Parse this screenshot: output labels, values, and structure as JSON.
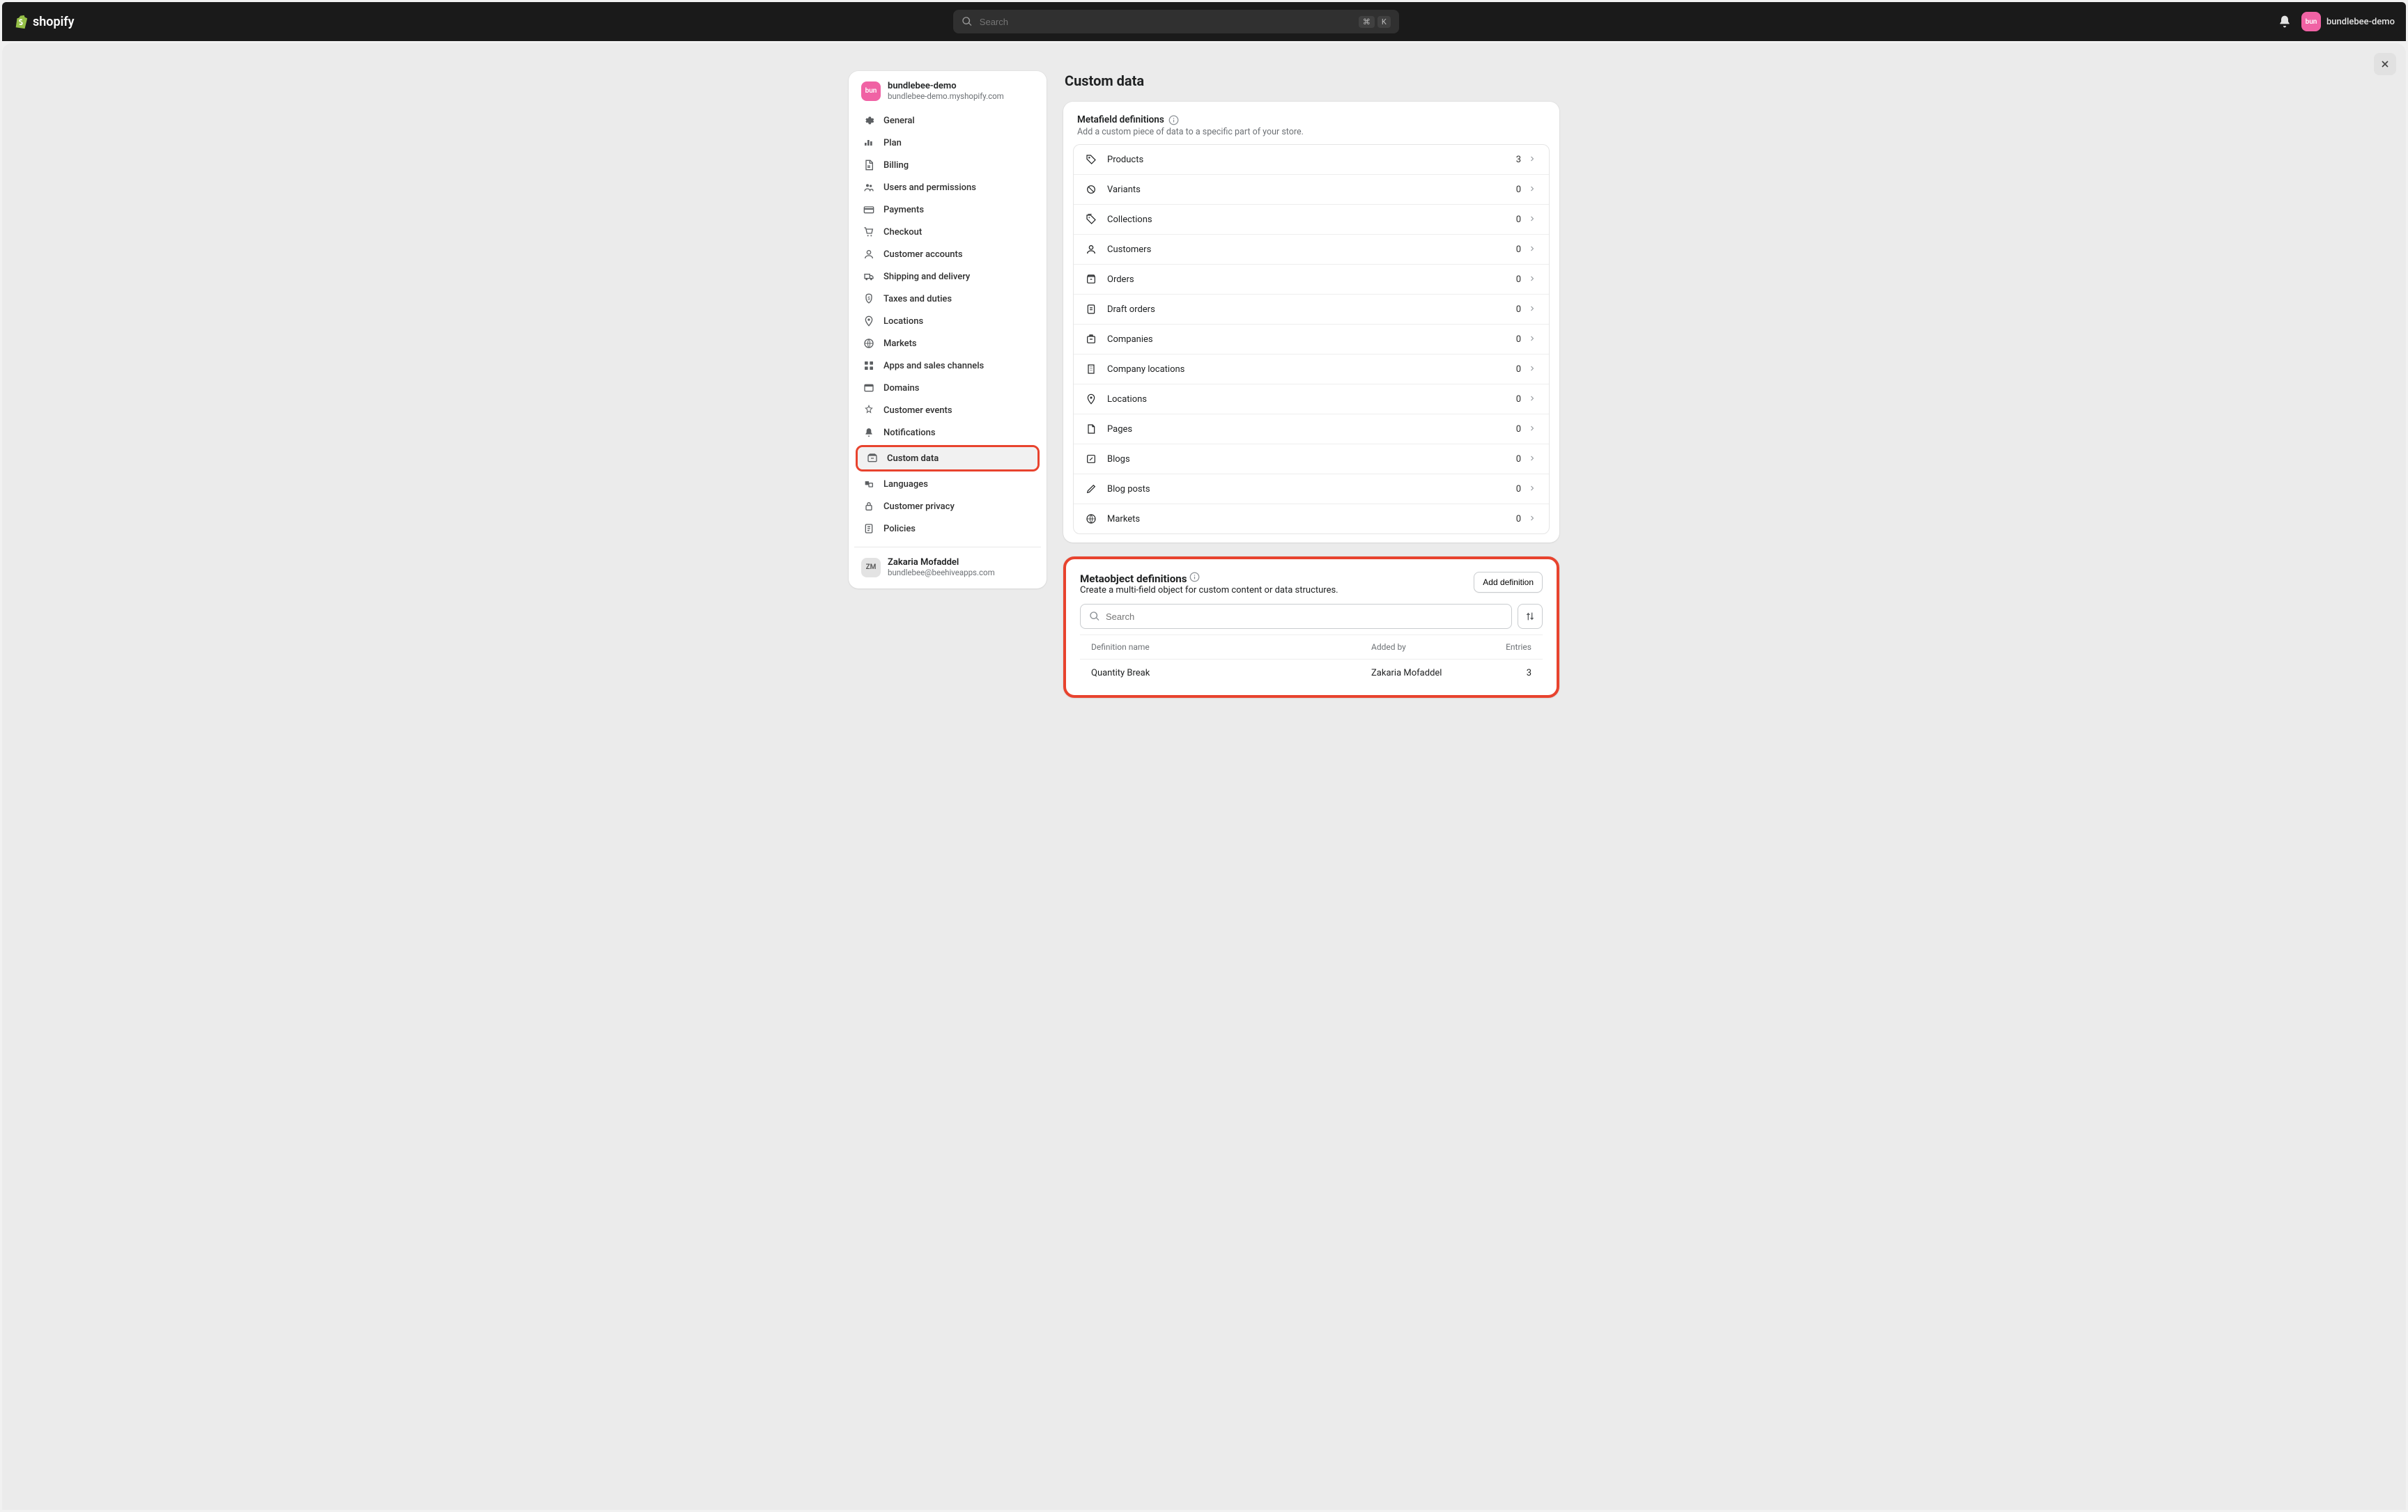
{
  "topbar": {
    "brand": "shopify",
    "search_placeholder": "Search",
    "kbd1": "⌘",
    "kbd2": "K",
    "avatar_text": "bun",
    "store_name": "bundlebee-demo"
  },
  "sidebar": {
    "store": {
      "avatar": "bun",
      "name": "bundlebee-demo",
      "domain": "bundlebee-demo.myshopify.com"
    },
    "items": [
      {
        "label": "General",
        "icon": "settings"
      },
      {
        "label": "Plan",
        "icon": "plan"
      },
      {
        "label": "Billing",
        "icon": "billing"
      },
      {
        "label": "Users and permissions",
        "icon": "users"
      },
      {
        "label": "Payments",
        "icon": "payments"
      },
      {
        "label": "Checkout",
        "icon": "checkout"
      },
      {
        "label": "Customer accounts",
        "icon": "customer"
      },
      {
        "label": "Shipping and delivery",
        "icon": "shipping"
      },
      {
        "label": "Taxes and duties",
        "icon": "taxes"
      },
      {
        "label": "Locations",
        "icon": "locations"
      },
      {
        "label": "Markets",
        "icon": "markets"
      },
      {
        "label": "Apps and sales channels",
        "icon": "apps"
      },
      {
        "label": "Domains",
        "icon": "domains"
      },
      {
        "label": "Customer events",
        "icon": "events"
      },
      {
        "label": "Notifications",
        "icon": "notifications"
      },
      {
        "label": "Custom data",
        "icon": "customdata"
      },
      {
        "label": "Languages",
        "icon": "languages"
      },
      {
        "label": "Customer privacy",
        "icon": "privacy"
      },
      {
        "label": "Policies",
        "icon": "policies"
      }
    ],
    "footer": {
      "initials": "ZM",
      "name": "Zakaria Mofaddel",
      "email": "bundlebee@beehiveapps.com"
    }
  },
  "main": {
    "title": "Custom data",
    "metafield": {
      "heading": "Metafield definitions",
      "subtitle": "Add a custom piece of data to a specific part of your store.",
      "rows": [
        {
          "label": "Products",
          "count": "3",
          "icon": "tag"
        },
        {
          "label": "Variants",
          "count": "0",
          "icon": "variant"
        },
        {
          "label": "Collections",
          "count": "0",
          "icon": "collection"
        },
        {
          "label": "Customers",
          "count": "0",
          "icon": "customer"
        },
        {
          "label": "Orders",
          "count": "0",
          "icon": "order"
        },
        {
          "label": "Draft orders",
          "count": "0",
          "icon": "draft"
        },
        {
          "label": "Companies",
          "count": "0",
          "icon": "company"
        },
        {
          "label": "Company locations",
          "count": "0",
          "icon": "building"
        },
        {
          "label": "Locations",
          "count": "0",
          "icon": "pin"
        },
        {
          "label": "Pages",
          "count": "0",
          "icon": "page"
        },
        {
          "label": "Blogs",
          "count": "0",
          "icon": "blog"
        },
        {
          "label": "Blog posts",
          "count": "0",
          "icon": "post"
        },
        {
          "label": "Markets",
          "count": "0",
          "icon": "globe"
        }
      ]
    },
    "metaobject": {
      "heading": "Metaobject definitions",
      "subtitle": "Create a multi-field object for custom content or data structures.",
      "add_button": "Add definition",
      "search_placeholder": "Search",
      "columns": {
        "name": "Definition name",
        "added": "Added by",
        "entries": "Entries"
      },
      "rows": [
        {
          "name": "Quantity Break",
          "added": "Zakaria Mofaddel",
          "entries": "3"
        }
      ]
    }
  }
}
